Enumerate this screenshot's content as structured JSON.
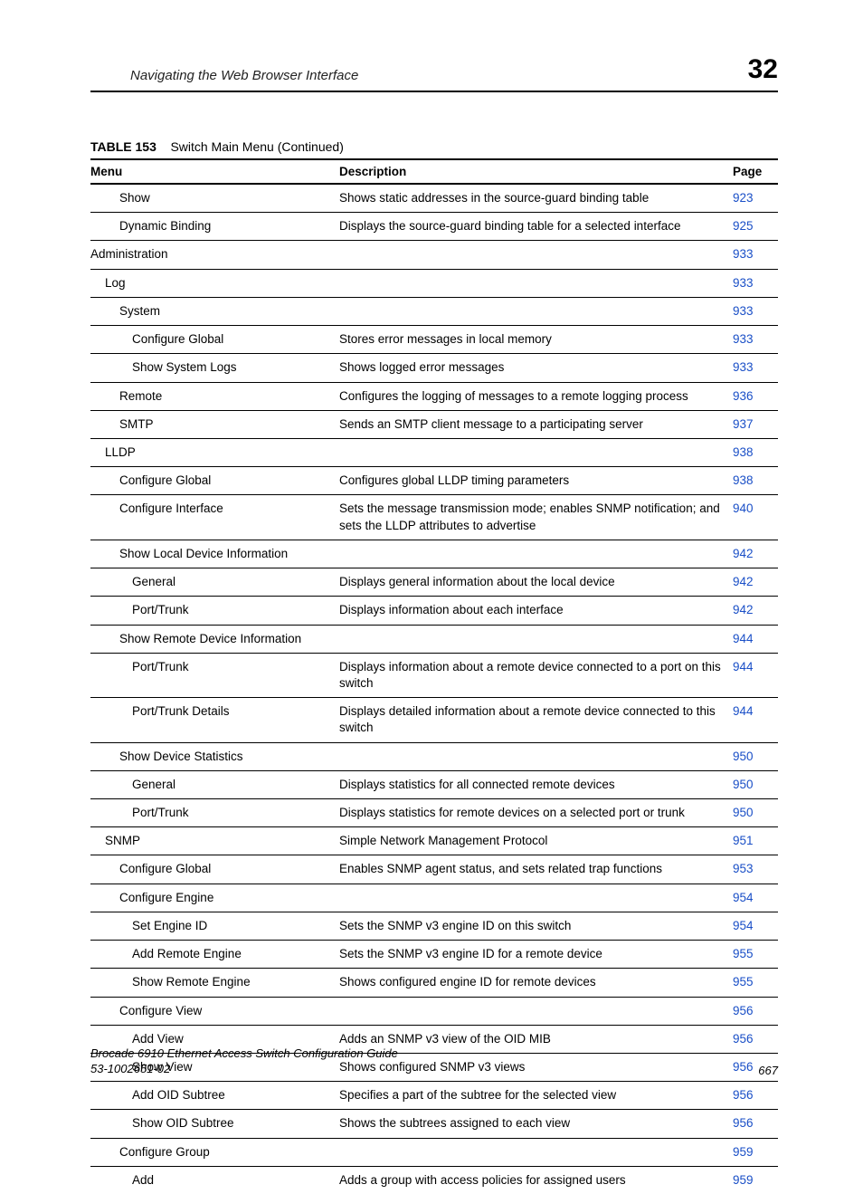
{
  "header": {
    "running_title": "Navigating the Web Browser Interface",
    "chapter_number": "32"
  },
  "table": {
    "label": "TABLE 153",
    "caption": "Switch Main Menu (Continued)",
    "columns": {
      "menu": "Menu",
      "description": "Description",
      "page": "Page"
    },
    "rows": [
      {
        "indent": 2,
        "menu": "Show",
        "description": "Shows static addresses in the source-guard binding table",
        "page": "923"
      },
      {
        "indent": 2,
        "menu": "Dynamic Binding",
        "description": "Displays the source-guard binding table for a selected interface",
        "page": "925"
      },
      {
        "indent": 0,
        "menu": "Administration",
        "description": "",
        "page": "933"
      },
      {
        "indent": 1,
        "menu": "Log",
        "description": "",
        "page": "933"
      },
      {
        "indent": 2,
        "menu": "System",
        "description": "",
        "page": "933"
      },
      {
        "indent": 3,
        "menu": "Configure Global",
        "description": "Stores error messages in local memory",
        "page": "933"
      },
      {
        "indent": 3,
        "menu": "Show System Logs",
        "description": "Shows logged error messages",
        "page": "933"
      },
      {
        "indent": 2,
        "menu": "Remote",
        "description": "Configures the logging of messages to a remote logging process",
        "page": "936"
      },
      {
        "indent": 2,
        "menu": "SMTP",
        "description": "Sends an SMTP client message to a participating server",
        "page": "937"
      },
      {
        "indent": 1,
        "menu": "LLDP",
        "description": "",
        "page": "938"
      },
      {
        "indent": 2,
        "menu": "Configure Global",
        "description": "Configures global LLDP timing parameters",
        "page": "938"
      },
      {
        "indent": 2,
        "menu": "Configure Interface",
        "description": "Sets the message transmission mode; enables SNMP notification; and sets the LLDP attributes to advertise",
        "page": "940"
      },
      {
        "indent": 2,
        "menu": "Show Local Device Information",
        "description": "",
        "page": "942"
      },
      {
        "indent": 3,
        "menu": "General",
        "description": "Displays general information about the local device",
        "page": "942"
      },
      {
        "indent": 3,
        "menu": "Port/Trunk",
        "description": "Displays information about each interface",
        "page": "942"
      },
      {
        "indent": 2,
        "menu": "Show Remote Device Information",
        "description": "",
        "page": "944"
      },
      {
        "indent": 3,
        "menu": "Port/Trunk",
        "description": "Displays information about a remote device connected to a port on this switch",
        "page": "944"
      },
      {
        "indent": 3,
        "menu": "Port/Trunk Details",
        "description": "Displays detailed information about a remote device connected to this switch",
        "page": "944"
      },
      {
        "indent": 2,
        "menu": "Show Device Statistics",
        "description": "",
        "page": "950"
      },
      {
        "indent": 3,
        "menu": "General",
        "description": "Displays statistics for all connected remote devices",
        "page": "950"
      },
      {
        "indent": 3,
        "menu": "Port/Trunk",
        "description": "Displays statistics for remote devices on a selected port or trunk",
        "page": "950"
      },
      {
        "indent": 1,
        "menu": "SNMP",
        "description": "Simple Network Management Protocol",
        "page": "951"
      },
      {
        "indent": 2,
        "menu": "Configure Global",
        "description": "Enables SNMP agent status, and sets related trap functions",
        "page": "953"
      },
      {
        "indent": 2,
        "menu": "Configure Engine",
        "description": "",
        "page": "954"
      },
      {
        "indent": 3,
        "menu": "Set Engine ID",
        "description": "Sets the SNMP v3 engine ID on this switch",
        "page": "954"
      },
      {
        "indent": 3,
        "menu": "Add Remote Engine",
        "description": "Sets the SNMP v3 engine ID for a remote device",
        "page": "955"
      },
      {
        "indent": 3,
        "menu": "Show Remote Engine",
        "description": "Shows configured engine ID for remote devices",
        "page": "955"
      },
      {
        "indent": 2,
        "menu": "Configure View",
        "description": "",
        "page": "956"
      },
      {
        "indent": 3,
        "menu": "Add View",
        "description": "Adds an SNMP v3 view of the OID MIB",
        "page": "956"
      },
      {
        "indent": 3,
        "menu": "Show View",
        "description": "Shows configured SNMP v3 views",
        "page": "956"
      },
      {
        "indent": 3,
        "menu": "Add OID Subtree",
        "description": "Specifies a part of the subtree for the selected view",
        "page": "956"
      },
      {
        "indent": 3,
        "menu": "Show OID Subtree",
        "description": "Shows the subtrees assigned to each view",
        "page": "956"
      },
      {
        "indent": 2,
        "menu": "Configure Group",
        "description": "",
        "page": "959"
      },
      {
        "indent": 3,
        "menu": "Add",
        "description": "Adds a group with access policies for assigned users",
        "page": "959"
      }
    ]
  },
  "footer": {
    "doc_title": "Brocade 6910 Ethernet Access Switch Configuration Guide",
    "doc_number": "53-1002651-02",
    "page_number": "667"
  }
}
